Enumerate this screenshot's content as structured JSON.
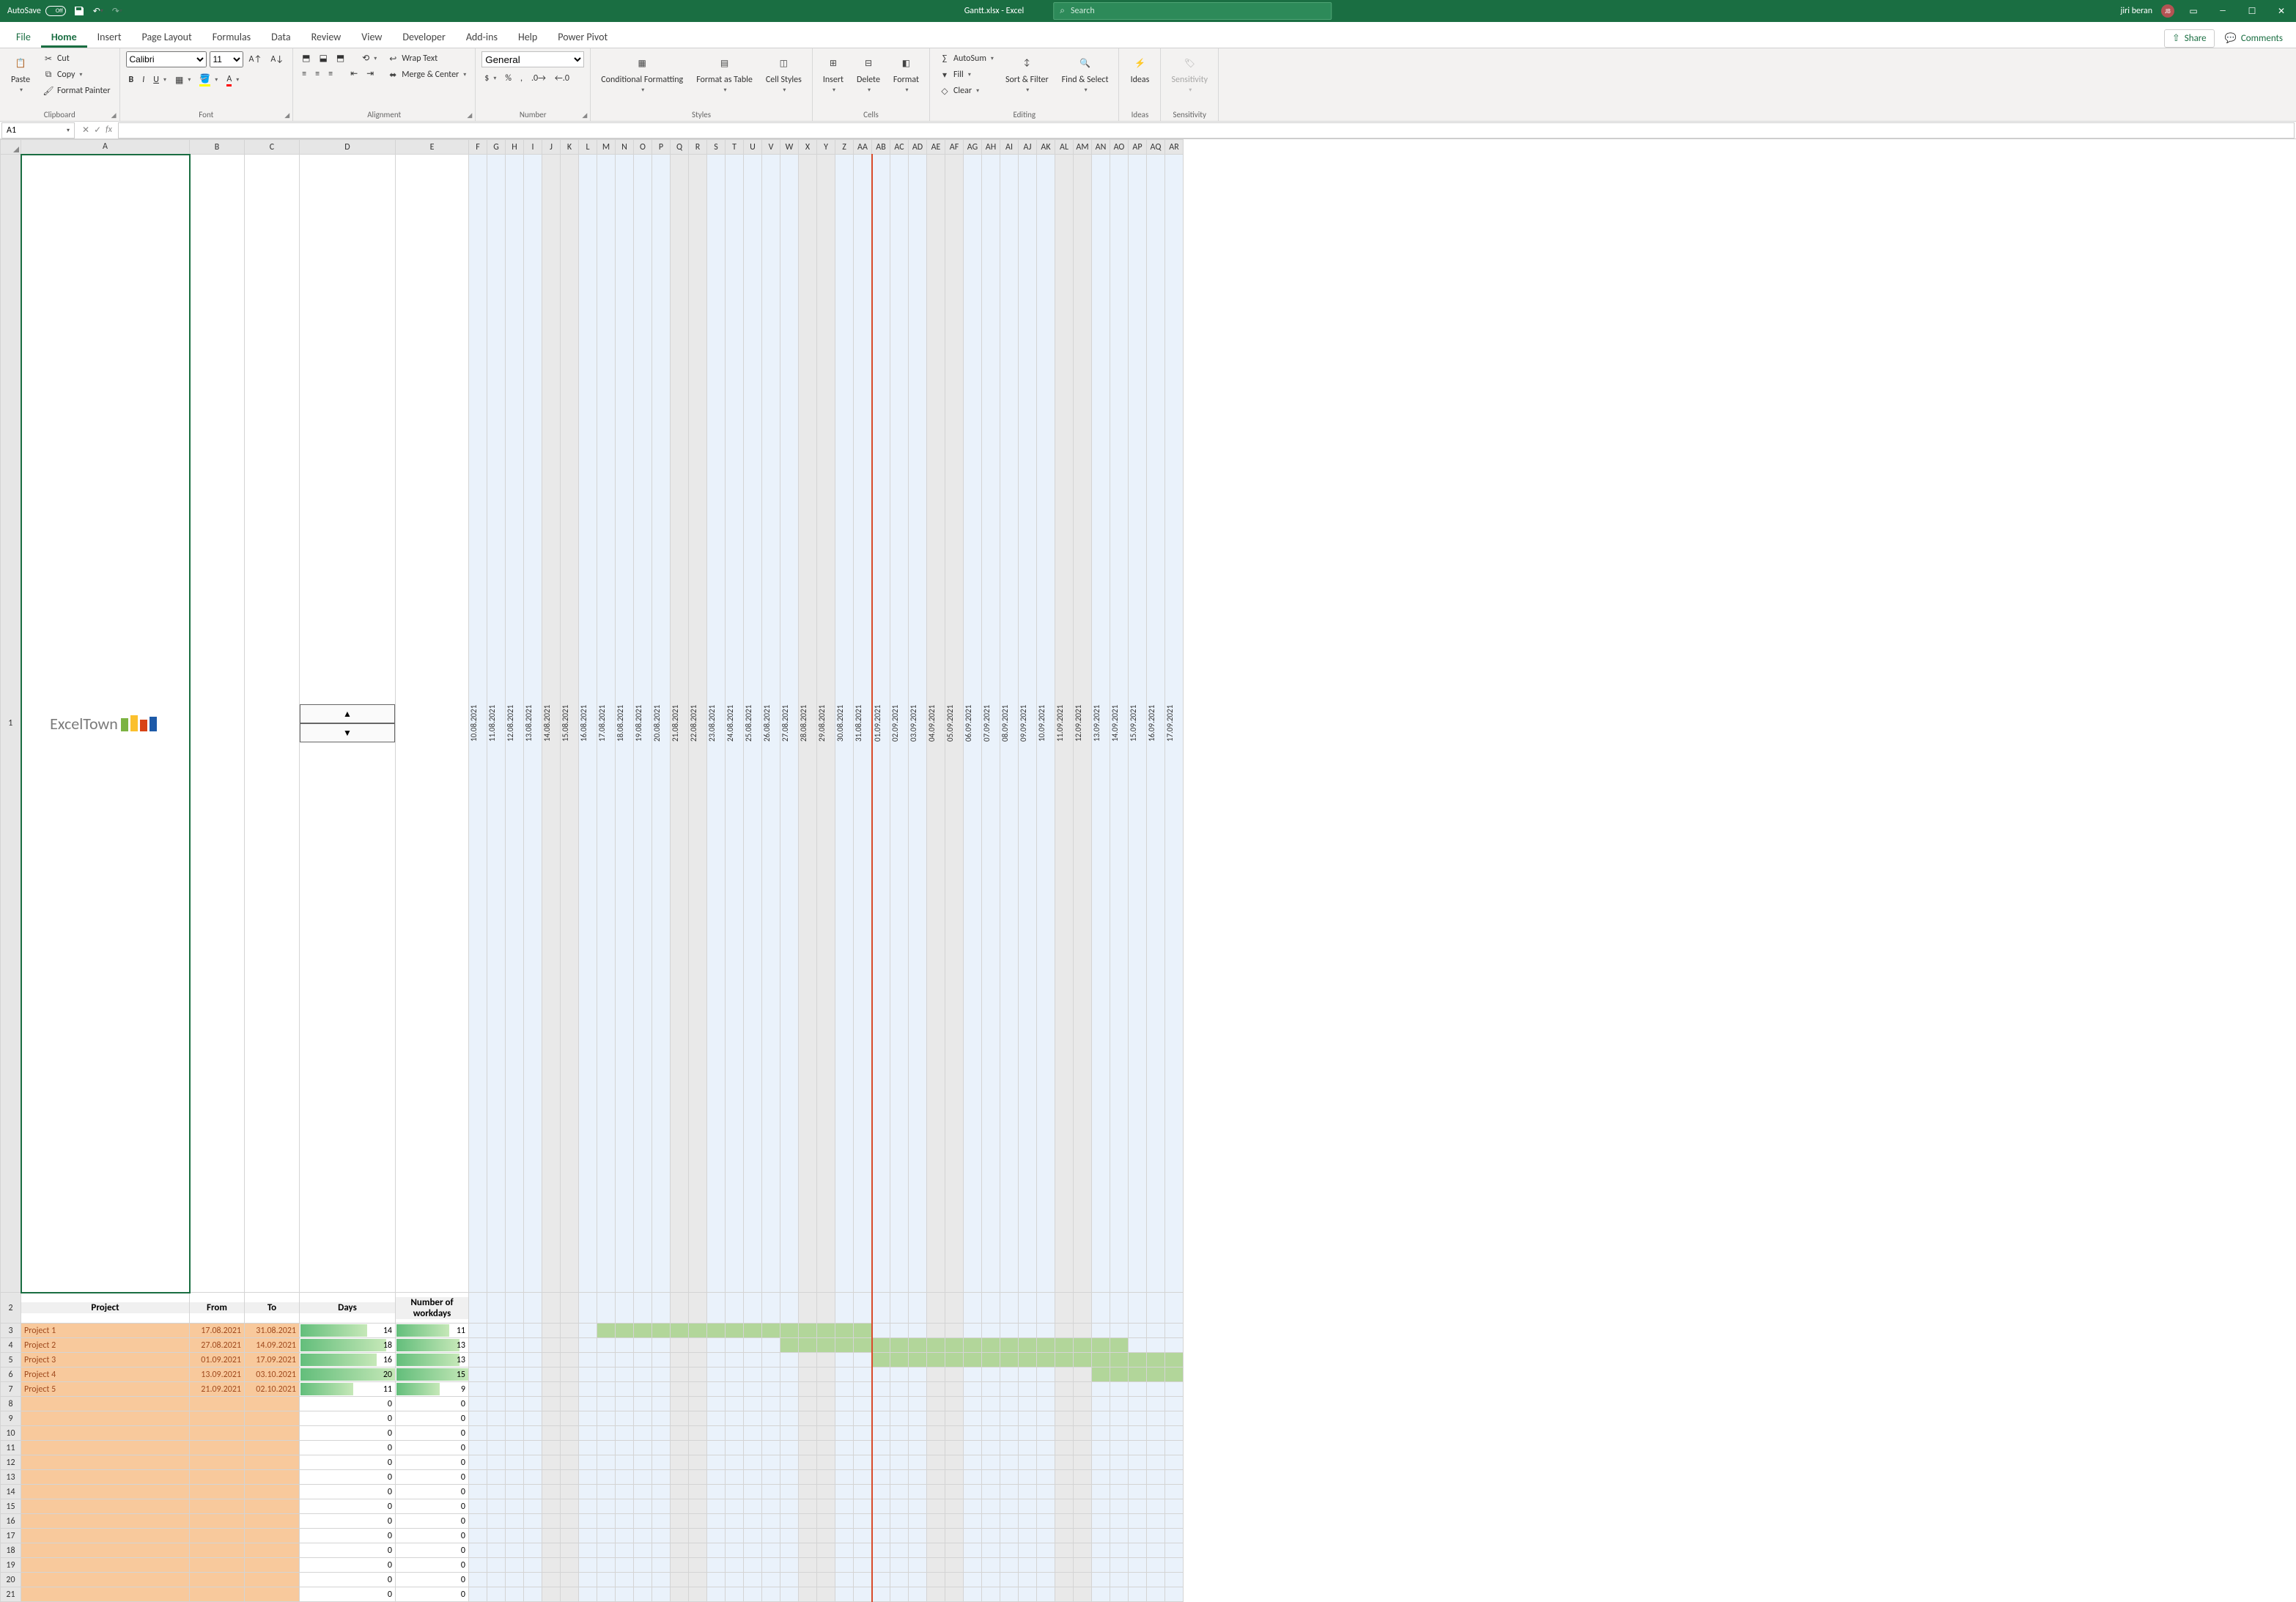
{
  "titlebar": {
    "autosave_label": "AutoSave",
    "autosave_state": "Off",
    "doc_title": "Gantt.xlsx - Excel",
    "search_placeholder": "Search",
    "user_name": "jiri beran",
    "user_initials": "JB"
  },
  "tabs": {
    "file": "File",
    "home": "Home",
    "insert": "Insert",
    "page_layout": "Page Layout",
    "formulas": "Formulas",
    "data": "Data",
    "review": "Review",
    "view": "View",
    "developer": "Developer",
    "addins": "Add-ins",
    "help": "Help",
    "power_pivot": "Power Pivot",
    "share": "Share",
    "comments": "Comments"
  },
  "ribbon": {
    "clipboard": {
      "paste": "Paste",
      "cut": "Cut",
      "copy": "Copy",
      "format_painter": "Format Painter",
      "label": "Clipboard"
    },
    "font": {
      "name": "Calibri",
      "size": "11",
      "label": "Font"
    },
    "alignment": {
      "wrap": "Wrap Text",
      "merge": "Merge & Center",
      "label": "Alignment"
    },
    "number": {
      "format": "General",
      "label": "Number"
    },
    "styles": {
      "cond": "Conditional Formatting",
      "table": "Format as Table",
      "cell": "Cell Styles",
      "label": "Styles"
    },
    "cells": {
      "insert": "Insert",
      "delete": "Delete",
      "format": "Format",
      "label": "Cells"
    },
    "editing": {
      "autosum": "AutoSum",
      "fill": "Fill",
      "clear": "Clear",
      "sort": "Sort & Filter",
      "find": "Find & Select",
      "label": "Editing"
    },
    "ideas": {
      "btn": "Ideas",
      "label": "Ideas"
    },
    "sensitivity": {
      "btn": "Sensitivity",
      "label": "Sensitivity"
    }
  },
  "namebox": "A1",
  "sheet": {
    "logo_text": "ExcelTown",
    "col_letters": [
      "A",
      "B",
      "C",
      "D",
      "E",
      "F",
      "G",
      "H",
      "I",
      "J",
      "K",
      "L",
      "M",
      "N",
      "O",
      "P",
      "Q",
      "R",
      "S",
      "T",
      "U",
      "V",
      "W",
      "X",
      "Y",
      "Z",
      "AA",
      "AB",
      "AC",
      "AD",
      "AE",
      "AF",
      "AG",
      "AH",
      "AI",
      "AJ",
      "AK",
      "AL",
      "AM",
      "AN",
      "AO",
      "AP",
      "AQ",
      "AR"
    ],
    "dates": [
      "10.08.2021",
      "11.08.2021",
      "12.08.2021",
      "13.08.2021",
      "14.08.2021",
      "15.08.2021",
      "16.08.2021",
      "17.08.2021",
      "18.08.2021",
      "19.08.2021",
      "20.08.2021",
      "21.08.2021",
      "22.08.2021",
      "23.08.2021",
      "24.08.2021",
      "25.08.2021",
      "26.08.2021",
      "27.08.2021",
      "28.08.2021",
      "29.08.2021",
      "30.08.2021",
      "31.08.2021",
      "01.09.2021",
      "02.09.2021",
      "03.09.2021",
      "04.09.2021",
      "05.09.2021",
      "06.09.2021",
      "07.09.2021",
      "08.09.2021",
      "09.09.2021",
      "10.09.2021",
      "11.09.2021",
      "12.09.2021",
      "13.09.2021",
      "14.09.2021",
      "15.09.2021",
      "16.09.2021",
      "17.09.2021"
    ],
    "weekend_idx": [
      4,
      5,
      11,
      12,
      18,
      19,
      25,
      26,
      32,
      33
    ],
    "today_idx": 21,
    "headers": {
      "project": "Project",
      "from": "From",
      "to": "To",
      "days": "Days",
      "workdays": "Number of workdays"
    },
    "projects": [
      {
        "name": "Project 1",
        "from": "17.08.2021",
        "to": "31.08.2021",
        "days": 14,
        "workdays": 11,
        "start_idx": 7,
        "end_idx": 21
      },
      {
        "name": "Project 2",
        "from": "27.08.2021",
        "to": "14.09.2021",
        "days": 18,
        "workdays": 13,
        "start_idx": 17,
        "end_idx": 35
      },
      {
        "name": "Project 3",
        "from": "01.09.2021",
        "to": "17.09.2021",
        "days": 16,
        "workdays": 13,
        "start_idx": 22,
        "end_idx": 38
      },
      {
        "name": "Project 4",
        "from": "13.09.2021",
        "to": "03.10.2021",
        "days": 20,
        "workdays": 15,
        "start_idx": 34,
        "end_idx": 38
      },
      {
        "name": "Project 5",
        "from": "21.09.2021",
        "to": "02.10.2021",
        "days": 11,
        "workdays": 9,
        "start_idx": 99,
        "end_idx": 99
      }
    ],
    "max_days": 20,
    "max_wd": 15
  }
}
